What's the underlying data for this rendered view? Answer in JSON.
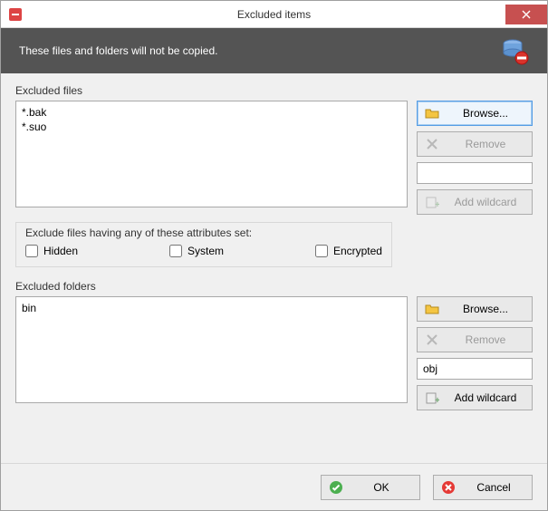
{
  "window": {
    "title": "Excluded items"
  },
  "header": {
    "description": "These files and folders will not be copied."
  },
  "excluded_files": {
    "label": "Excluded files",
    "items_text": "*.bak\n*.suo",
    "browse_label": "Browse...",
    "remove_label": "Remove",
    "wildcard_value": "",
    "add_wildcard_label": "Add wildcard",
    "attributes": {
      "title": "Exclude files having any of these attributes set:",
      "hidden": "Hidden",
      "system": "System",
      "encrypted": "Encrypted"
    }
  },
  "excluded_folders": {
    "label": "Excluded folders",
    "items_text": "bin",
    "browse_label": "Browse...",
    "remove_label": "Remove",
    "wildcard_value": "obj",
    "add_wildcard_label": "Add wildcard"
  },
  "footer": {
    "ok": "OK",
    "cancel": "Cancel"
  }
}
